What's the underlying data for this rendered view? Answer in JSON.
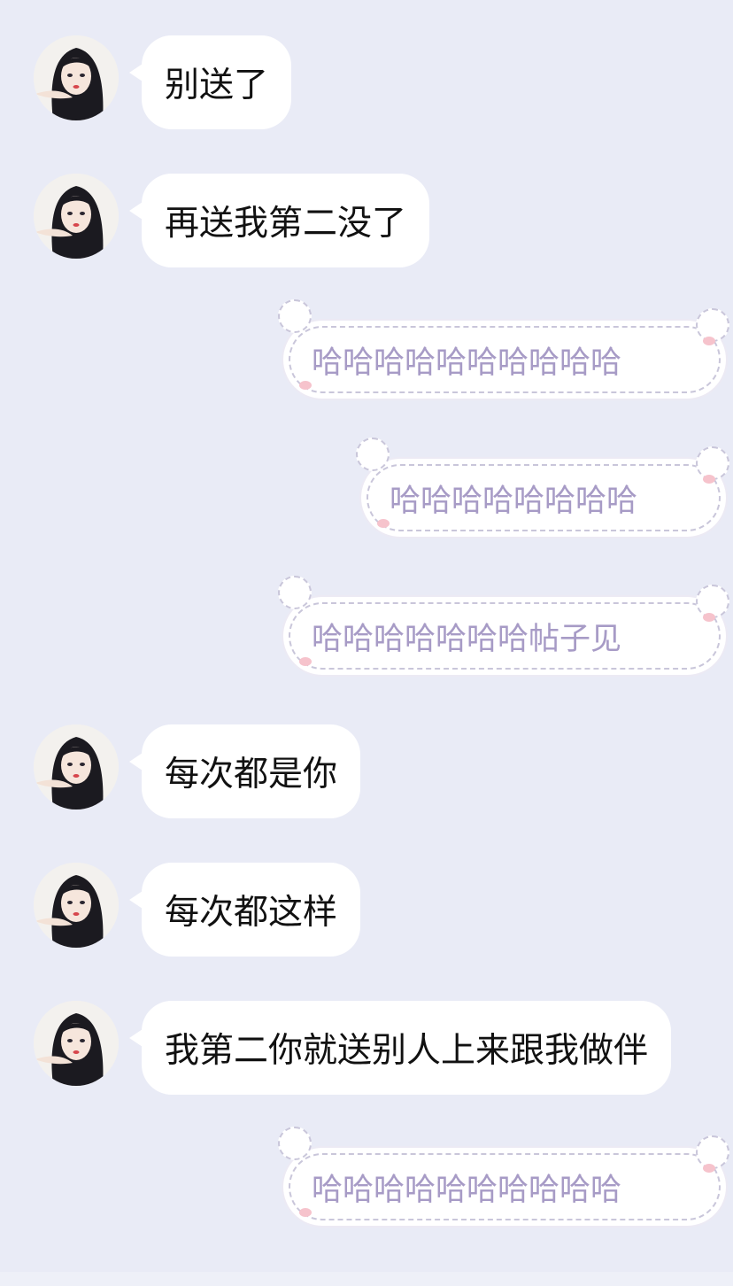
{
  "chat": {
    "incoming_group_1": [
      {
        "text": "别送了"
      },
      {
        "text": "再送我第二没了"
      }
    ],
    "outgoing_group_1": [
      {
        "text": "哈哈哈哈哈哈哈哈哈哈"
      },
      {
        "text": "哈哈哈哈哈哈哈哈"
      },
      {
        "text": "哈哈哈哈哈哈哈帖子见"
      }
    ],
    "incoming_group_2": [
      {
        "text": "每次都是你"
      },
      {
        "text": "每次都这样"
      },
      {
        "text": "我第二你就送别人上来跟我做伴"
      }
    ],
    "outgoing_group_2": [
      {
        "text": "哈哈哈哈哈哈哈哈哈哈"
      }
    ]
  },
  "theme": {
    "background": "#e9ebf6",
    "incoming_bubble": "#ffffff",
    "outgoing_text": "#a79bc6"
  },
  "icons": {
    "avatar": "anime-girl-avatar",
    "outgoing_decoration": "cat-bubble-decoration"
  }
}
